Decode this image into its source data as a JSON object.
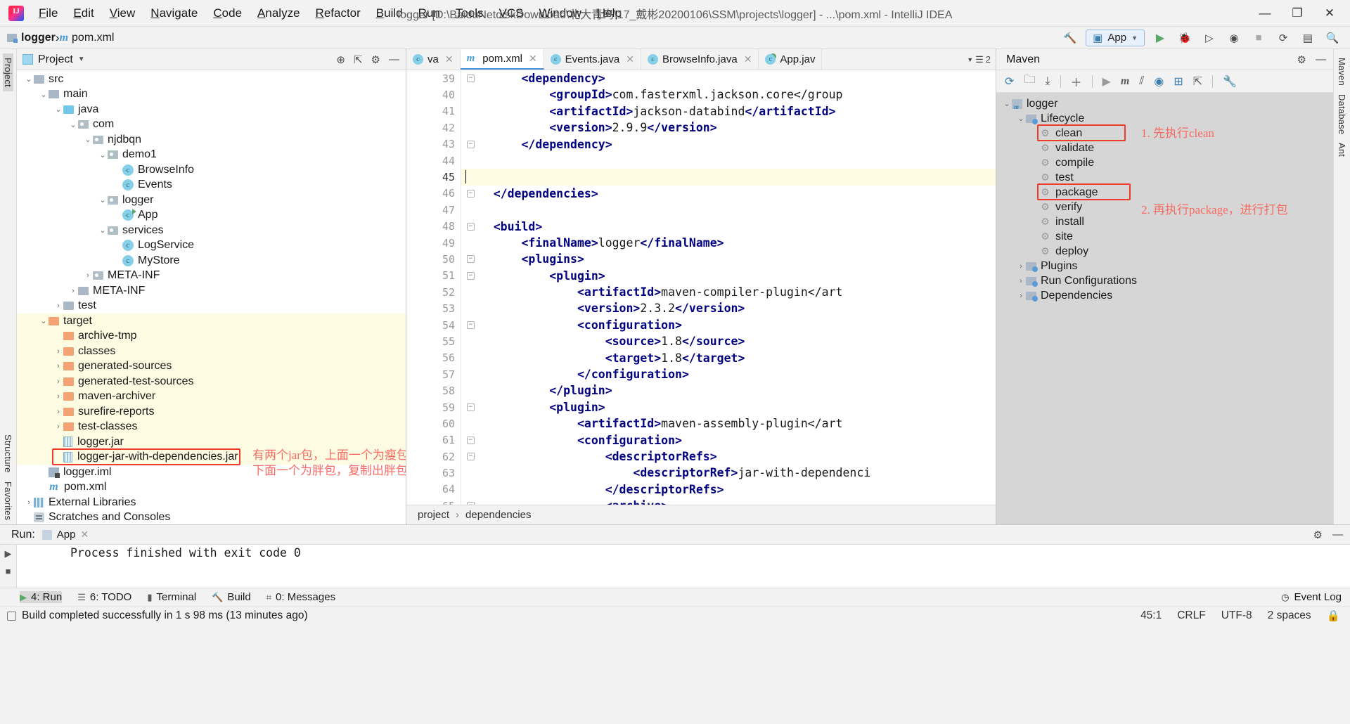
{
  "titlebar": {
    "logo": "intellij-logo",
    "menus": [
      "File",
      "Edit",
      "View",
      "Navigate",
      "Code",
      "Analyze",
      "Refactor",
      "Build",
      "Run",
      "Tools",
      "VCS",
      "Window",
      "Help"
    ],
    "window_title": "logger [D:\\BaiduNetdiskDownload\\北大青鸟\\17_戴彬20200106\\SSM\\projects\\logger] - ...\\pom.xml - IntelliJ IDEA",
    "minimize": "—",
    "maximize": "❐",
    "close": "✕"
  },
  "navbar": {
    "project_crumb": "logger",
    "file_crumb": "pom.xml",
    "separator": "›",
    "run_config": "App",
    "icons": [
      "hammer-icon",
      "run-icon",
      "debug-icon",
      "coverage-icon",
      "profile-icon",
      "stop-icon",
      "update-icon",
      "layout-icon",
      "search-icon"
    ]
  },
  "project_panel": {
    "title": "Project",
    "header_icons": [
      "locate-icon",
      "collapse-all-icon",
      "settings-icon",
      "hide-icon"
    ],
    "tree": [
      {
        "label": "src",
        "depth": 1,
        "arrow": "v",
        "icon": "folder-grey"
      },
      {
        "label": "main",
        "depth": 2,
        "arrow": "v",
        "icon": "folder-grey"
      },
      {
        "label": "java",
        "depth": 3,
        "arrow": "v",
        "icon": "folder-blue"
      },
      {
        "label": "com",
        "depth": 4,
        "arrow": "v",
        "icon": "folder-package"
      },
      {
        "label": "njdbqn",
        "depth": 5,
        "arrow": "v",
        "icon": "folder-package"
      },
      {
        "label": "demo1",
        "depth": 6,
        "arrow": "v",
        "icon": "folder-package"
      },
      {
        "label": "BrowseInfo",
        "depth": 7,
        "arrow": "",
        "icon": "class"
      },
      {
        "label": "Events",
        "depth": 7,
        "arrow": "",
        "icon": "class"
      },
      {
        "label": "logger",
        "depth": 6,
        "arrow": "v",
        "icon": "folder-package"
      },
      {
        "label": "App",
        "depth": 7,
        "arrow": "",
        "icon": "class-runnable"
      },
      {
        "label": "services",
        "depth": 6,
        "arrow": "v",
        "icon": "folder-package"
      },
      {
        "label": "LogService",
        "depth": 7,
        "arrow": "",
        "icon": "class"
      },
      {
        "label": "MyStore",
        "depth": 7,
        "arrow": "",
        "icon": "class"
      },
      {
        "label": "META-INF",
        "depth": 5,
        "arrow": ">",
        "icon": "folder-package"
      },
      {
        "label": "META-INF",
        "depth": 4,
        "arrow": ">",
        "icon": "folder-grey"
      },
      {
        "label": "test",
        "depth": 3,
        "arrow": ">",
        "icon": "folder-grey"
      },
      {
        "label": "target",
        "depth": 2,
        "arrow": "v",
        "icon": "folder-orange",
        "highlight": true
      },
      {
        "label": "archive-tmp",
        "depth": 3,
        "arrow": "",
        "icon": "folder-orange",
        "highlight": true
      },
      {
        "label": "classes",
        "depth": 3,
        "arrow": ">",
        "icon": "folder-orange",
        "highlight": true
      },
      {
        "label": "generated-sources",
        "depth": 3,
        "arrow": ">",
        "icon": "folder-orange",
        "highlight": true
      },
      {
        "label": "generated-test-sources",
        "depth": 3,
        "arrow": ">",
        "icon": "folder-orange",
        "highlight": true
      },
      {
        "label": "maven-archiver",
        "depth": 3,
        "arrow": ">",
        "icon": "folder-orange",
        "highlight": true
      },
      {
        "label": "surefire-reports",
        "depth": 3,
        "arrow": ">",
        "icon": "folder-orange",
        "highlight": true
      },
      {
        "label": "test-classes",
        "depth": 3,
        "arrow": ">",
        "icon": "folder-orange",
        "highlight": true
      },
      {
        "label": "logger.jar",
        "depth": 3,
        "arrow": "",
        "icon": "jar",
        "highlight": true
      },
      {
        "label": "logger-jar-with-dependencies.jar",
        "depth": 3,
        "arrow": "",
        "icon": "jar",
        "highlight": true
      },
      {
        "label": "logger.iml",
        "depth": 2,
        "arrow": "",
        "icon": "iml"
      },
      {
        "label": "pom.xml",
        "depth": 2,
        "arrow": "",
        "icon": "pom"
      },
      {
        "label": "External Libraries",
        "depth": 1,
        "arrow": ">",
        "icon": "library"
      },
      {
        "label": "Scratches and Consoles",
        "depth": 1,
        "arrow": "",
        "icon": "scratch"
      }
    ],
    "annotation": {
      "line1": "有两个jar包，上面一个为瘦包，",
      "line2": "下面一个为胖包，复制出胖包。"
    }
  },
  "editor": {
    "tabs": [
      {
        "label": "va",
        "icon": "java-class",
        "active": false,
        "closable": true
      },
      {
        "label": "pom.xml",
        "icon": "maven",
        "active": true,
        "closable": true
      },
      {
        "label": "Events.java",
        "icon": "java-class",
        "active": false,
        "closable": true
      },
      {
        "label": "BrowseInfo.java",
        "icon": "java-class",
        "active": false,
        "closable": true
      },
      {
        "label": "App.jav",
        "icon": "java-runnable",
        "active": false,
        "closable": false
      }
    ],
    "tab_overflow": "2",
    "lines": [
      {
        "num": 39,
        "text": "        <dependency>",
        "fold": true,
        "partial": true
      },
      {
        "num": 40,
        "text": "            <groupId>com.fasterxml.jackson.core</group"
      },
      {
        "num": 41,
        "text": "            <artifactId>jackson-databind</artifactId>"
      },
      {
        "num": 42,
        "text": "            <version>2.9.9</version>"
      },
      {
        "num": 43,
        "text": "        </dependency>",
        "fold": true
      },
      {
        "num": 44,
        "text": ""
      },
      {
        "num": 45,
        "text": "",
        "current": true
      },
      {
        "num": 46,
        "text": "    </dependencies>",
        "fold": true
      },
      {
        "num": 47,
        "text": ""
      },
      {
        "num": 48,
        "text": "    <build>",
        "fold": true
      },
      {
        "num": 49,
        "text": "        <finalName>logger</finalName>"
      },
      {
        "num": 50,
        "text": "        <plugins>",
        "fold": true
      },
      {
        "num": 51,
        "text": "            <plugin>",
        "fold": true
      },
      {
        "num": 52,
        "text": "                <artifactId>maven-compiler-plugin</art"
      },
      {
        "num": 53,
        "text": "                <version>2.3.2</version>"
      },
      {
        "num": 54,
        "text": "                <configuration>",
        "fold": true
      },
      {
        "num": 55,
        "text": "                    <source>1.8</source>"
      },
      {
        "num": 56,
        "text": "                    <target>1.8</target>"
      },
      {
        "num": 57,
        "text": "                </configuration>"
      },
      {
        "num": 58,
        "text": "            </plugin>"
      },
      {
        "num": 59,
        "text": "            <plugin>",
        "fold": true
      },
      {
        "num": 60,
        "text": "                <artifactId>maven-assembly-plugin</art"
      },
      {
        "num": 61,
        "text": "                <configuration>",
        "fold": true
      },
      {
        "num": 62,
        "text": "                    <descriptorRefs>",
        "fold": true
      },
      {
        "num": 63,
        "text": "                        <descriptorRef>jar-with-dependenci"
      },
      {
        "num": 64,
        "text": "                    </descriptorRefs>"
      },
      {
        "num": 65,
        "text": "                    <archive>",
        "fold": true
      }
    ],
    "breadcrumbs": [
      "project",
      "dependencies"
    ],
    "breadcrumb_sep": "›"
  },
  "maven_panel": {
    "title": "Maven",
    "header_icons": [
      "settings-icon",
      "hide-icon"
    ],
    "toolbar_icons": [
      "reload-icon",
      "add-folder-icon",
      "download-sources-icon",
      "plus-icon",
      "run-icon",
      "maven-icon",
      "skip-tests-icon",
      "offline-icon",
      "show-diagram-icon",
      "collapse-icon",
      "toggle-icon",
      "wrench-icon"
    ],
    "tree": [
      {
        "label": "logger",
        "depth": 1,
        "arrow": "v",
        "icon": "maven-project"
      },
      {
        "label": "Lifecycle",
        "depth": 2,
        "arrow": "v",
        "icon": "folder-maven"
      },
      {
        "label": "clean",
        "depth": 3,
        "arrow": "",
        "icon": "goal",
        "boxed": true
      },
      {
        "label": "validate",
        "depth": 3,
        "arrow": "",
        "icon": "goal"
      },
      {
        "label": "compile",
        "depth": 3,
        "arrow": "",
        "icon": "goal"
      },
      {
        "label": "test",
        "depth": 3,
        "arrow": "",
        "icon": "goal"
      },
      {
        "label": "package",
        "depth": 3,
        "arrow": "",
        "icon": "goal",
        "boxed": true
      },
      {
        "label": "verify",
        "depth": 3,
        "arrow": "",
        "icon": "goal"
      },
      {
        "label": "install",
        "depth": 3,
        "arrow": "",
        "icon": "goal"
      },
      {
        "label": "site",
        "depth": 3,
        "arrow": "",
        "icon": "goal"
      },
      {
        "label": "deploy",
        "depth": 3,
        "arrow": "",
        "icon": "goal"
      },
      {
        "label": "Plugins",
        "depth": 2,
        "arrow": ">",
        "icon": "folder-maven"
      },
      {
        "label": "Run Configurations",
        "depth": 2,
        "arrow": ">",
        "icon": "folder-maven"
      },
      {
        "label": "Dependencies",
        "depth": 2,
        "arrow": ">",
        "icon": "folder-maven"
      }
    ],
    "annotations": {
      "clean_note": "1. 先执行clean",
      "package_note": "2. 再执行package，进行打包"
    }
  },
  "left_strip": {
    "labels": [
      "Project",
      "Structure",
      "Favorites"
    ]
  },
  "right_strip": {
    "labels": [
      "Maven",
      "Database",
      "Ant"
    ]
  },
  "run_panel": {
    "label": "Run:",
    "config_name": "App",
    "close": "✕",
    "console_text": "Process finished with exit code 0",
    "header_icons": [
      "settings-icon",
      "hide-icon"
    ]
  },
  "tool_window_bar": {
    "items": [
      {
        "label": "4: Run",
        "icon": "run-icon",
        "selected": true
      },
      {
        "label": "6: TODO",
        "icon": "todo-icon",
        "selected": false
      },
      {
        "label": "Terminal",
        "icon": "terminal-icon",
        "selected": false
      },
      {
        "label": "Build",
        "icon": "build-icon",
        "selected": false
      },
      {
        "label": "0: Messages",
        "icon": "messages-icon",
        "selected": false
      }
    ],
    "event_log": "Event Log"
  },
  "statusbar": {
    "message": "Build completed successfully in 1 s 98 ms (13 minutes ago)",
    "caret": "45:1",
    "line_separator": "CRLF",
    "encoding": "UTF-8",
    "indent": "2 spaces",
    "lock": "🔒"
  },
  "colors": {
    "accent_blue": "#4a90d9",
    "annotation_red": "#f03a2e",
    "annotation_text": "#f76b63",
    "target_highlight": "#fdfbe2",
    "tag_color": "#000080"
  }
}
